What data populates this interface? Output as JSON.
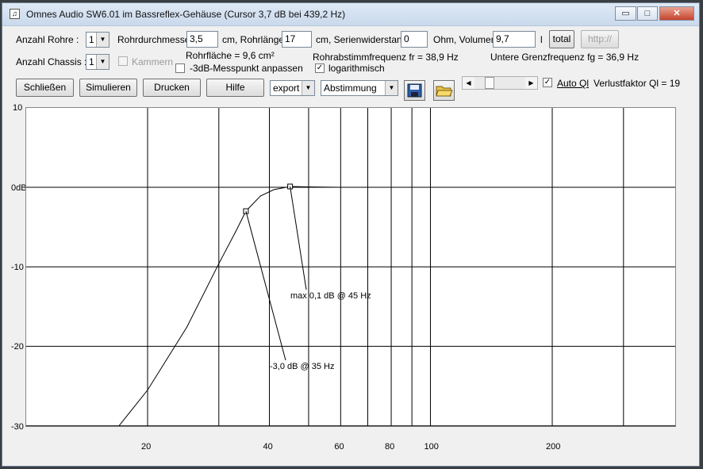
{
  "window": {
    "title": "Omnes Audio SW6.01 im Bassreflex-Gehäuse (Cursor 3,7 dB bei 439,2 Hz)",
    "icon": "speaker-app-icon",
    "caption_minimize": "▭",
    "caption_maximize": "□",
    "caption_close": "✕"
  },
  "params": {
    "anzahl_rohre_label": "Anzahl Rohre :",
    "anzahl_rohre_value": "1",
    "rohrdurchmesser_label": "Rohrdurchmesser",
    "rohrdurchmesser_value": "3,5",
    "rohrdurchmesser_unit": "cm, Rohrlänge",
    "rohrlaenge_value": "17",
    "rohrlaenge_unit": "cm, Serienwiderstand",
    "serienwiderstand_value": "0",
    "serienwiderstand_unit": "Ohm, Volumen",
    "volumen_value": "9,7",
    "volumen_unit": "l",
    "total_label": "total",
    "http_label": "http://",
    "anzahl_chassis_label": "Anzahl Chassis :",
    "anzahl_chassis_value": "1",
    "kammern_label": "Kammern",
    "rohrflaeche": "Rohrfläche = 9,6 cm²",
    "rohrabstimm": "Rohrabstimmfrequenz fr = 38,9 Hz",
    "untere_grenz": "Untere Grenzfrequenz fg = 36,9 Hz",
    "messpunkt_label": "-3dB-Messpunkt anpassen",
    "logarithmisch_label": "logarithmisch",
    "auto_ql_label": "Auto Ql",
    "verlustfaktor": "Verlustfaktor Ql = 19"
  },
  "toolbar": {
    "schliessen": "Schließen",
    "simulieren": "Simulieren",
    "drucken": "Drucken",
    "hilfe": "Hilfe",
    "export_value": "export",
    "abstimmung_value": "Abstimmung"
  },
  "chart_data": {
    "type": "line",
    "x_scale": "log",
    "xlim": [
      12,
      400
    ],
    "ylim": [
      -30,
      10
    ],
    "y_ticks": [
      10,
      0,
      -10,
      -20,
      -30
    ],
    "y_tick_labels": [
      "10",
      "0dB",
      "-10",
      "-20",
      "-30"
    ],
    "x_tick_labels": [
      {
        "value": 20,
        "label": "20"
      },
      {
        "value": 40,
        "label": "40"
      },
      {
        "value": 60,
        "label": "60"
      },
      {
        "value": 80,
        "label": "80"
      },
      {
        "value": 100,
        "label": "100"
      },
      {
        "value": 200,
        "label": "200"
      }
    ],
    "x_gridlines": [
      20,
      30,
      40,
      50,
      60,
      70,
      80,
      90,
      100,
      200,
      300
    ],
    "series": [
      {
        "x": [
          17,
          20,
          25,
          30,
          33,
          35,
          38,
          41,
          45,
          50,
          60,
          80,
          100,
          150,
          200,
          250
        ],
        "y": [
          -30,
          -25.5,
          -17.6,
          -9.6,
          -5.6,
          -3.0,
          -1.1,
          -0.3,
          0.1,
          0.05,
          0.0,
          0.0,
          0.0,
          0.0,
          0.0,
          0.0
        ]
      }
    ],
    "annotations": [
      {
        "x": 35,
        "y": -3.0,
        "text": "-3,0 dB @ 35 Hz"
      },
      {
        "x": 45,
        "y": 0.1,
        "text": "max 0,1 dB @ 45 Hz"
      }
    ]
  }
}
